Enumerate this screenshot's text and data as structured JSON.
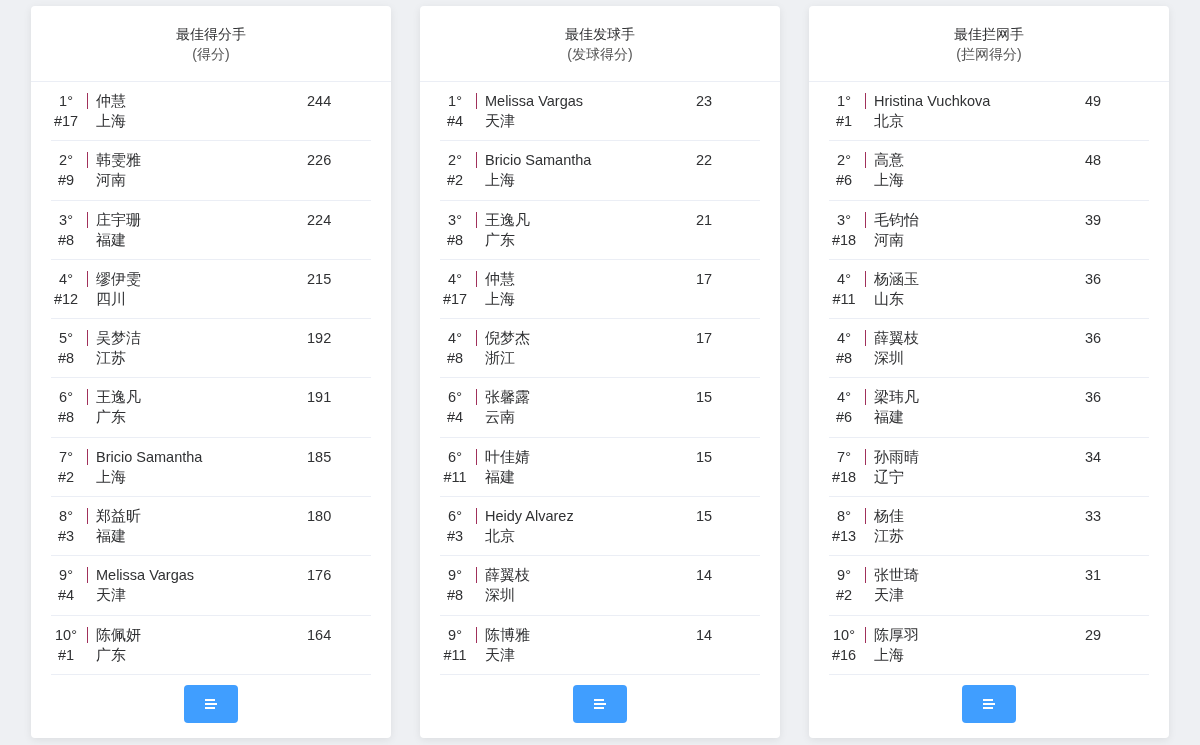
{
  "cards": [
    {
      "title": "最佳得分手",
      "subtitle": "(得分)",
      "rows": [
        {
          "rank": "1°",
          "number": "#17",
          "name": "仲慧",
          "region": "上海",
          "score": "244"
        },
        {
          "rank": "2°",
          "number": "#9",
          "name": "韩雯雅",
          "region": "河南",
          "score": "226"
        },
        {
          "rank": "3°",
          "number": "#8",
          "name": "庄宇珊",
          "region": "福建",
          "score": "224"
        },
        {
          "rank": "4°",
          "number": "#12",
          "name": "缪伊雯",
          "region": "四川",
          "score": "215"
        },
        {
          "rank": "5°",
          "number": "#8",
          "name": "吴梦洁",
          "region": "江苏",
          "score": "192"
        },
        {
          "rank": "6°",
          "number": "#8",
          "name": "王逸凡",
          "region": "广东",
          "score": "191"
        },
        {
          "rank": "7°",
          "number": "#2",
          "name": "Bricio Samantha",
          "region": "上海",
          "score": "185"
        },
        {
          "rank": "8°",
          "number": "#3",
          "name": "郑益昕",
          "region": "福建",
          "score": "180"
        },
        {
          "rank": "9°",
          "number": "#4",
          "name": "Melissa Vargas",
          "region": "天津",
          "score": "176"
        },
        {
          "rank": "10°",
          "number": "#1",
          "name": "陈佩妍",
          "region": "广东",
          "score": "164"
        }
      ]
    },
    {
      "title": "最佳发球手",
      "subtitle": "(发球得分)",
      "rows": [
        {
          "rank": "1°",
          "number": "#4",
          "name": "Melissa Vargas",
          "region": "天津",
          "score": "23"
        },
        {
          "rank": "2°",
          "number": "#2",
          "name": "Bricio Samantha",
          "region": "上海",
          "score": "22"
        },
        {
          "rank": "3°",
          "number": "#8",
          "name": "王逸凡",
          "region": "广东",
          "score": "21"
        },
        {
          "rank": "4°",
          "number": "#17",
          "name": "仲慧",
          "region": "上海",
          "score": "17"
        },
        {
          "rank": "4°",
          "number": "#8",
          "name": "倪梦杰",
          "region": "浙江",
          "score": "17"
        },
        {
          "rank": "6°",
          "number": "#4",
          "name": "张馨露",
          "region": "云南",
          "score": "15"
        },
        {
          "rank": "6°",
          "number": "#11",
          "name": "叶佳婧",
          "region": "福建",
          "score": "15"
        },
        {
          "rank": "6°",
          "number": "#3",
          "name": "Heidy Alvarez",
          "region": "北京",
          "score": "15"
        },
        {
          "rank": "9°",
          "number": "#8",
          "name": "薛翼枝",
          "region": "深圳",
          "score": "14"
        },
        {
          "rank": "9°",
          "number": "#11",
          "name": "陈博雅",
          "region": "天津",
          "score": "14"
        }
      ]
    },
    {
      "title": "最佳拦网手",
      "subtitle": "(拦网得分)",
      "rows": [
        {
          "rank": "1°",
          "number": "#1",
          "name": "Hristina Vuchkova",
          "region": "北京",
          "score": "49"
        },
        {
          "rank": "2°",
          "number": "#6",
          "name": "高意",
          "region": "上海",
          "score": "48"
        },
        {
          "rank": "3°",
          "number": "#18",
          "name": "毛钧怡",
          "region": "河南",
          "score": "39"
        },
        {
          "rank": "4°",
          "number": "#11",
          "name": "杨涵玉",
          "region": "山东",
          "score": "36"
        },
        {
          "rank": "4°",
          "number": "#8",
          "name": "薛翼枝",
          "region": "深圳",
          "score": "36"
        },
        {
          "rank": "4°",
          "number": "#6",
          "name": "梁玮凡",
          "region": "福建",
          "score": "36"
        },
        {
          "rank": "7°",
          "number": "#18",
          "name": "孙雨晴",
          "region": "辽宁",
          "score": "34"
        },
        {
          "rank": "8°",
          "number": "#13",
          "name": "杨佳",
          "region": "江苏",
          "score": "33"
        },
        {
          "rank": "9°",
          "number": "#2",
          "name": "张世琦",
          "region": "天津",
          "score": "31"
        },
        {
          "rank": "10°",
          "number": "#16",
          "name": "陈厚羽",
          "region": "上海",
          "score": "29"
        }
      ]
    }
  ]
}
